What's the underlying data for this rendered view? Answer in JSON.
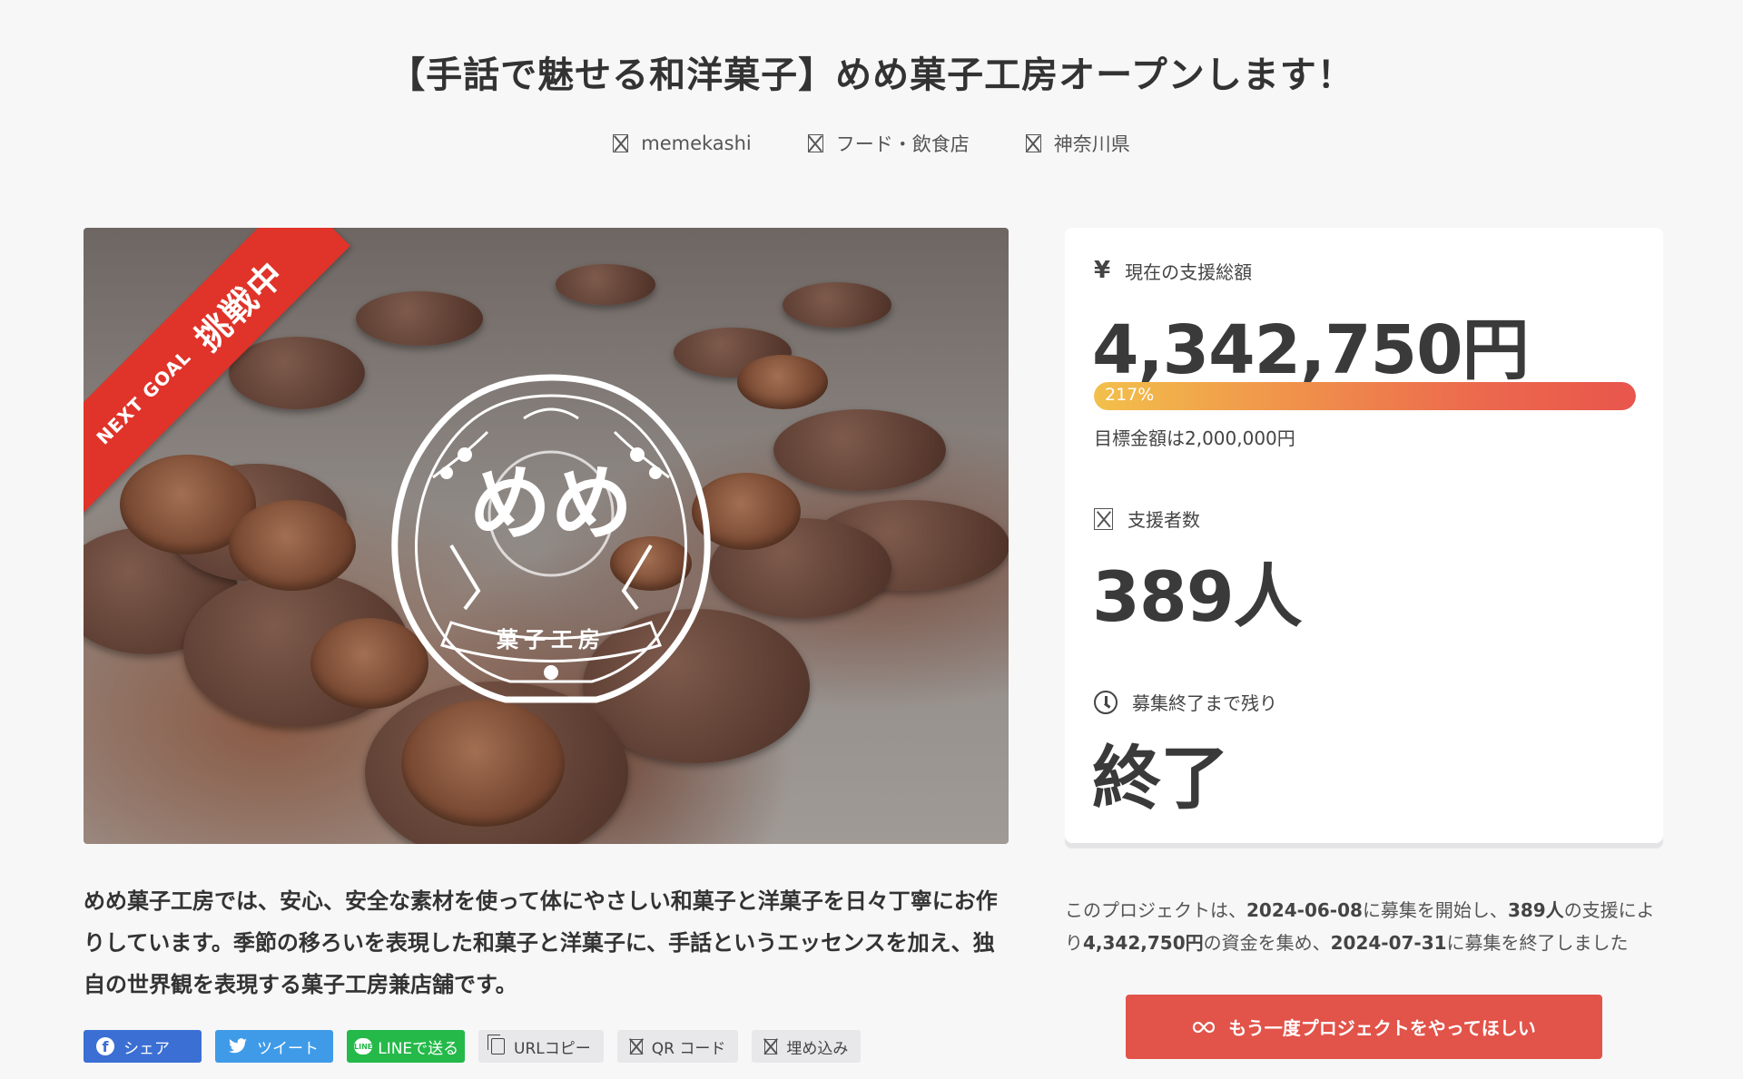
{
  "title": "【手話で魅せる和洋菓子】めめ菓子工房オープンします！",
  "meta": {
    "owner": "memekashi",
    "category": "フード・飲食店",
    "location": "神奈川県"
  },
  "hero": {
    "ribbon_next": "NEXT GOAL",
    "ribbon_main": "挑戦中",
    "logo_main": "めめ",
    "logo_sub": "菓子工房"
  },
  "stats": {
    "total_label": "現在の支援総額",
    "total_icon": "yen-icon",
    "total_symbol": "¥",
    "total_value": "4,342,750円",
    "progress_percent_text": "217%",
    "progress_fraction": 1.0,
    "goal_text": "目標金額は2,000,000円",
    "backers_label": "支援者数",
    "backers_value": "389人",
    "remaining_label": "募集終了まで残り",
    "remaining_value": "終了"
  },
  "description": "めめ菓子工房では、安心、安全な素材を使って体にやさしい和菓子と洋菓子を日々丁寧にお作りしています。季節の移ろいを表現した和菓子と洋菓子に、手話というエッセンスを加え、独自の世界観を表現する菓子工房兼店舗です。",
  "share": {
    "facebook": "シェア",
    "twitter": "ツイート",
    "line": "LINEで送る",
    "line_icon_text": "LINE",
    "url_copy": "URLコピー",
    "qr": "QR コード",
    "embed": "埋め込み"
  },
  "summary": {
    "p1": "このプロジェクトは、",
    "start_date": "2024-06-08",
    "p2": "に募集を開始し、",
    "backers": "389人",
    "p3": "の支援により",
    "amount": "4,342,750円",
    "p4": "の資金を集め、",
    "end_date": "2024-07-31",
    "p5": "に募集を終了しました"
  },
  "cta": {
    "label": "もう一度プロジェクトをやってほしい",
    "icon": "infinity-icon"
  },
  "colors": {
    "background": "#f7f7f8",
    "ribbon": "#e0332a",
    "cta": "#e25349",
    "facebook": "#3b6fd4",
    "twitter": "#3f9be8",
    "line": "#25b94a"
  }
}
